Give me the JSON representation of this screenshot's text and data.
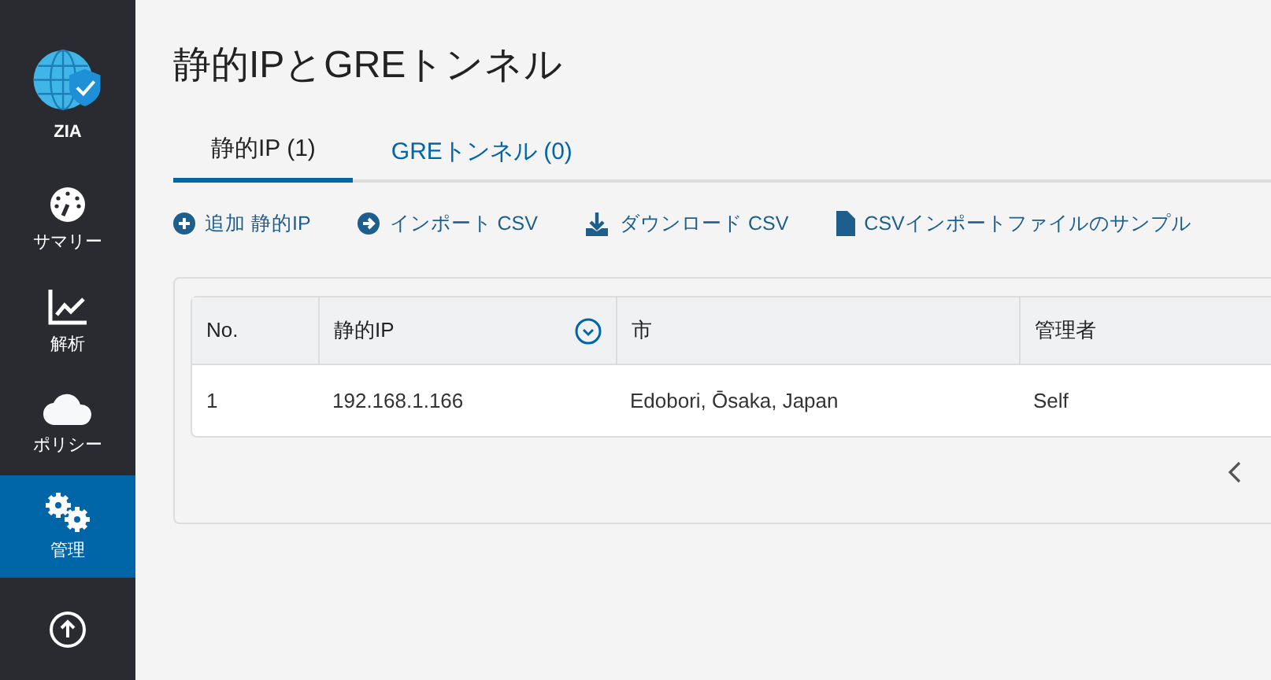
{
  "sidebar": {
    "items": [
      {
        "kind": "logo",
        "label": "ZIA",
        "selected": false
      },
      {
        "kind": "gauge",
        "label": "サマリー",
        "selected": false
      },
      {
        "kind": "chart",
        "label": "解析",
        "selected": false
      },
      {
        "kind": "cloud",
        "label": "ポリシー",
        "selected": false
      },
      {
        "kind": "gears",
        "label": "管理",
        "selected": true
      },
      {
        "kind": "upload",
        "selected": false
      }
    ]
  },
  "page": {
    "title": "静的IPとGREトンネル"
  },
  "tabs": [
    {
      "label": "静的IP (1)",
      "selected": true
    },
    {
      "label": "GREトンネル (0)",
      "selected": false
    }
  ],
  "actions": [
    {
      "kind": "add",
      "label": "追加 静的IP"
    },
    {
      "kind": "import",
      "label": "インポート CSV"
    },
    {
      "kind": "download",
      "label": "ダウンロード CSV"
    },
    {
      "kind": "file",
      "label": "CSVインポートファイルのサンプル"
    }
  ],
  "table": {
    "columns": [
      {
        "label": "No."
      },
      {
        "label": "静的IP",
        "menu": true
      },
      {
        "label": "市"
      },
      {
        "label": "管理者"
      }
    ],
    "rows": [
      [
        "1",
        "192.168.1.166",
        "Edobori, Ōsaka, Japan",
        "Self"
      ]
    ]
  },
  "pagination": {
    "previous": true
  }
}
